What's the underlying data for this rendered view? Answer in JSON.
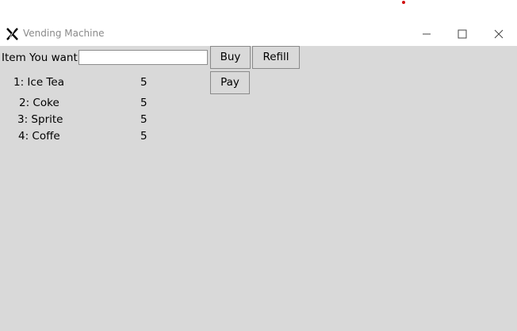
{
  "window": {
    "title": "Vending Machine"
  },
  "form": {
    "item_label": "Item You want",
    "item_value": ""
  },
  "buttons": {
    "buy": "Buy",
    "refill": "Refill",
    "pay": "Pay"
  },
  "items": [
    {
      "label": "1: Ice Tea",
      "count": "5"
    },
    {
      "label": "2: Coke",
      "count": "5"
    },
    {
      "label": "3: Sprite",
      "count": "5"
    },
    {
      "label": "4: Coffe",
      "count": "5"
    }
  ]
}
